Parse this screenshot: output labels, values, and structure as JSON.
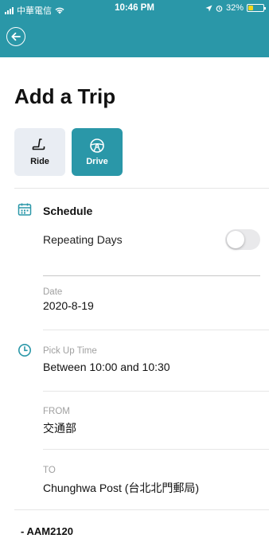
{
  "status_bar": {
    "carrier": "中華電信",
    "time": "10:46 PM",
    "battery": "32%",
    "battery_level": 0.32
  },
  "page": {
    "title": "Add a Trip"
  },
  "modes": [
    {
      "label": "Ride",
      "icon": "seat-icon",
      "selected": false
    },
    {
      "label": "Drive",
      "icon": "steering-wheel-icon",
      "selected": true
    }
  ],
  "schedule": {
    "title": "Schedule",
    "repeating_label": "Repeating Days",
    "repeating_enabled": false
  },
  "date": {
    "label": "Date",
    "value": "2020-8-19"
  },
  "pickup": {
    "label": "Pick Up Time",
    "value": "Between 10:00 and 10:30"
  },
  "from": {
    "label": "FROM",
    "value": "交通部"
  },
  "to": {
    "label": "TO",
    "value": "Chunghwa Post (台北北門郵局)"
  },
  "vehicle": {
    "plate": "- AAM2120"
  },
  "colors": {
    "accent": "#2a97a8",
    "ride_bg": "#e9edf3",
    "label_gray": "#a0a0a0"
  }
}
